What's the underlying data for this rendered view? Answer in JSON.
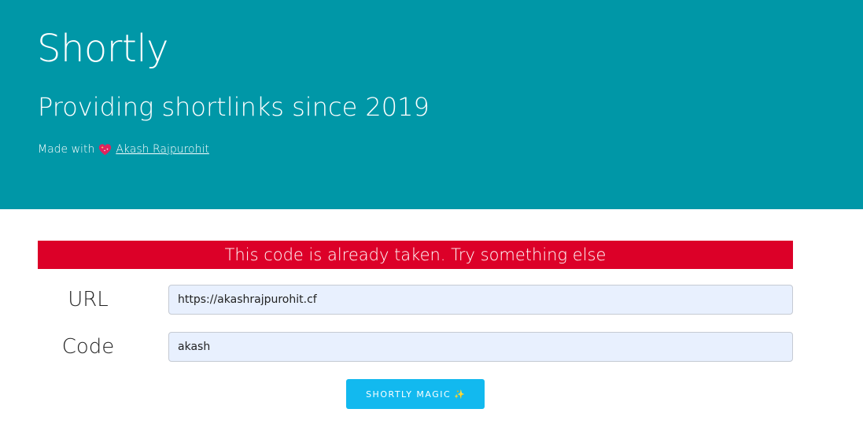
{
  "hero": {
    "title": "Shortly",
    "subtitle": "Providing shortlinks since 2019",
    "credit_prefix": "Made with",
    "credit_icon": "sparkling-heart-icon",
    "author_name": "Akash Rajpurohit",
    "background_color": "#0097a7"
  },
  "alert": {
    "message": "This code is already taken. Try something else",
    "color": "#dc0028"
  },
  "form": {
    "url_label": "URL",
    "url_value": "https://akashrajpurohit.cf",
    "code_label": "Code",
    "code_value": "akash",
    "submit_label": "Shortly magic",
    "submit_icon": "✨",
    "submit_color": "#12b9ef"
  }
}
